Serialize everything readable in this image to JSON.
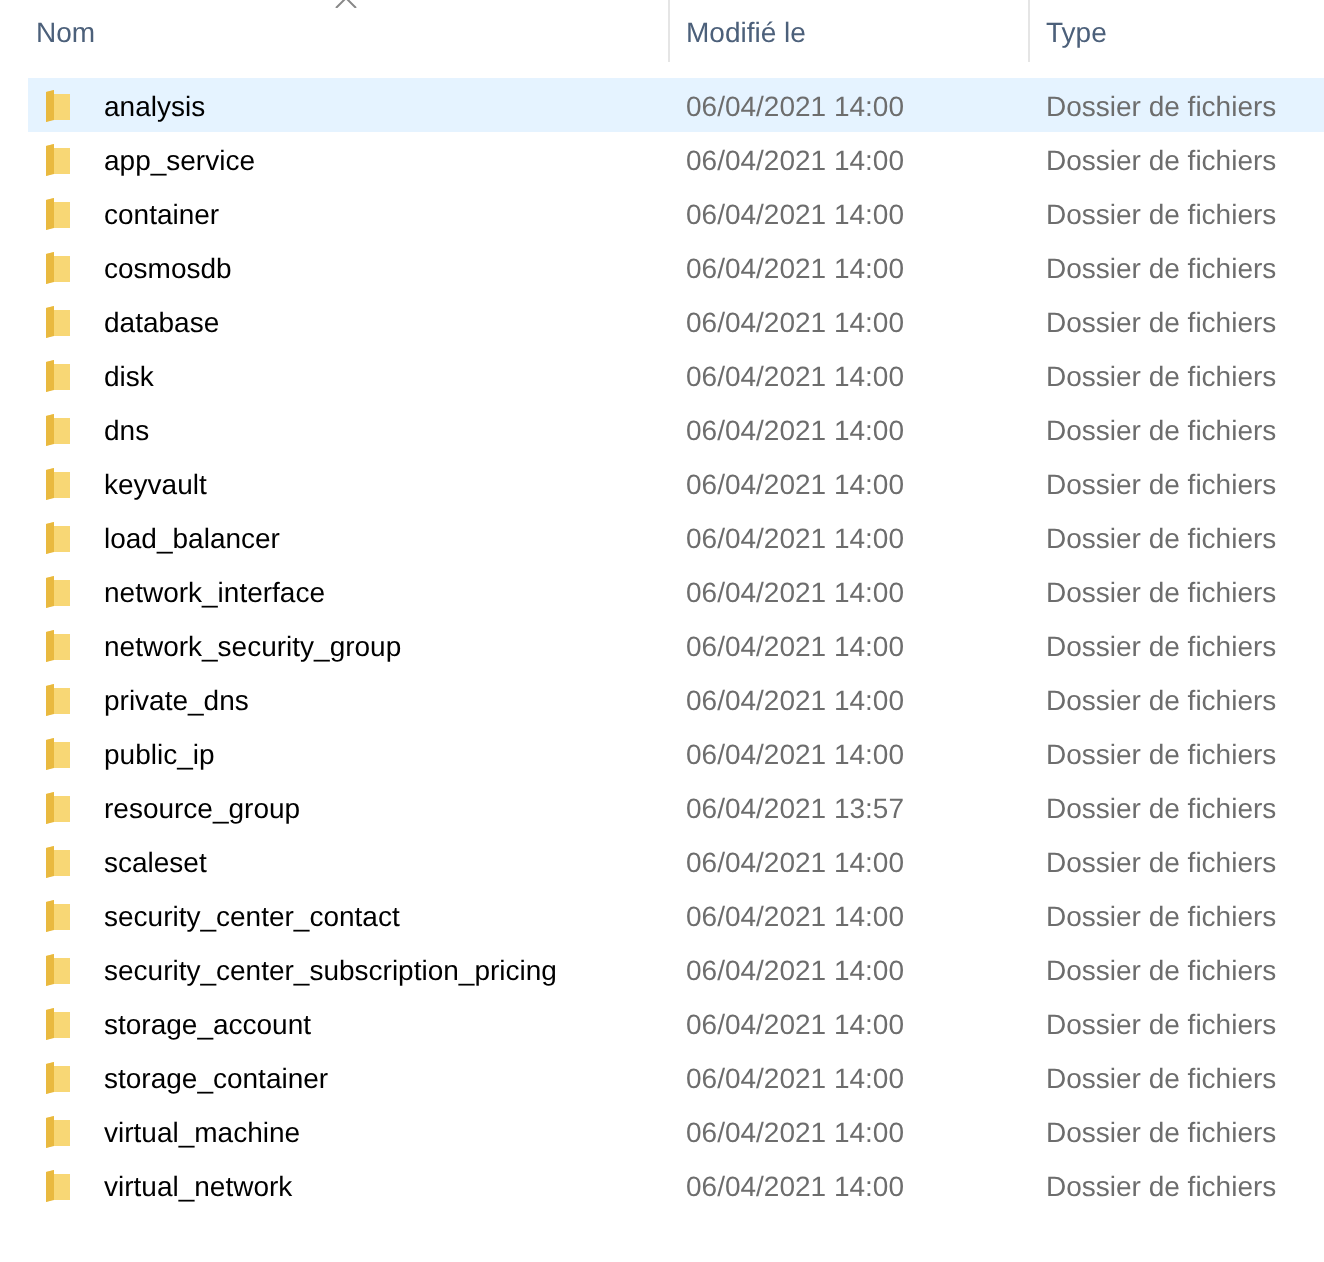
{
  "columns": [
    "Nom",
    "Modifié le",
    "Type"
  ],
  "rows": [
    {
      "name": "analysis",
      "modified": "06/04/2021 14:00",
      "type": "Dossier de fichiers",
      "selected": true
    },
    {
      "name": "app_service",
      "modified": "06/04/2021 14:00",
      "type": "Dossier de fichiers",
      "selected": false
    },
    {
      "name": "container",
      "modified": "06/04/2021 14:00",
      "type": "Dossier de fichiers",
      "selected": false
    },
    {
      "name": "cosmosdb",
      "modified": "06/04/2021 14:00",
      "type": "Dossier de fichiers",
      "selected": false
    },
    {
      "name": "database",
      "modified": "06/04/2021 14:00",
      "type": "Dossier de fichiers",
      "selected": false
    },
    {
      "name": "disk",
      "modified": "06/04/2021 14:00",
      "type": "Dossier de fichiers",
      "selected": false
    },
    {
      "name": "dns",
      "modified": "06/04/2021 14:00",
      "type": "Dossier de fichiers",
      "selected": false
    },
    {
      "name": "keyvault",
      "modified": "06/04/2021 14:00",
      "type": "Dossier de fichiers",
      "selected": false
    },
    {
      "name": "load_balancer",
      "modified": "06/04/2021 14:00",
      "type": "Dossier de fichiers",
      "selected": false
    },
    {
      "name": "network_interface",
      "modified": "06/04/2021 14:00",
      "type": "Dossier de fichiers",
      "selected": false
    },
    {
      "name": "network_security_group",
      "modified": "06/04/2021 14:00",
      "type": "Dossier de fichiers",
      "selected": false
    },
    {
      "name": "private_dns",
      "modified": "06/04/2021 14:00",
      "type": "Dossier de fichiers",
      "selected": false
    },
    {
      "name": "public_ip",
      "modified": "06/04/2021 14:00",
      "type": "Dossier de fichiers",
      "selected": false
    },
    {
      "name": "resource_group",
      "modified": "06/04/2021 13:57",
      "type": "Dossier de fichiers",
      "selected": false
    },
    {
      "name": "scaleset",
      "modified": "06/04/2021 14:00",
      "type": "Dossier de fichiers",
      "selected": false
    },
    {
      "name": "security_center_contact",
      "modified": "06/04/2021 14:00",
      "type": "Dossier de fichiers",
      "selected": false
    },
    {
      "name": "security_center_subscription_pricing",
      "modified": "06/04/2021 14:00",
      "type": "Dossier de fichiers",
      "selected": false
    },
    {
      "name": "storage_account",
      "modified": "06/04/2021 14:00",
      "type": "Dossier de fichiers",
      "selected": false
    },
    {
      "name": "storage_container",
      "modified": "06/04/2021 14:00",
      "type": "Dossier de fichiers",
      "selected": false
    },
    {
      "name": "virtual_machine",
      "modified": "06/04/2021 14:00",
      "type": "Dossier de fichiers",
      "selected": false
    },
    {
      "name": "virtual_network",
      "modified": "06/04/2021 14:00",
      "type": "Dossier de fichiers",
      "selected": false
    }
  ]
}
